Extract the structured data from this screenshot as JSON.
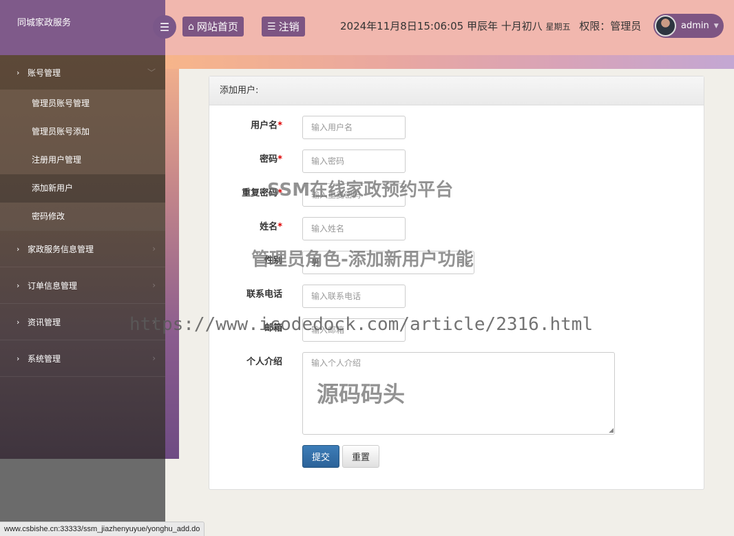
{
  "brand": {
    "title": "同城家政服务"
  },
  "header": {
    "home_label": "网站首页",
    "logout_label": "注销",
    "datetime": "2024年11月8日15:06:05 甲辰年 十月初八",
    "weekday": "星期五",
    "permission": "权限：管理员",
    "username": "admin"
  },
  "sidebar": {
    "groups": [
      {
        "label": "账号管理",
        "items": [
          {
            "label": "管理员账号管理"
          },
          {
            "label": "管理员账号添加"
          },
          {
            "label": "注册用户管理"
          },
          {
            "label": "添加新用户",
            "active": true
          },
          {
            "label": "密码修改"
          }
        ]
      },
      {
        "label": "家政服务信息管理"
      },
      {
        "label": "订单信息管理"
      },
      {
        "label": "资讯管理"
      },
      {
        "label": "系统管理"
      }
    ]
  },
  "form": {
    "heading": "添加用户:",
    "fields": {
      "username": {
        "label": "用户名",
        "required": "*",
        "placeholder": "输入用户名"
      },
      "password": {
        "label": "密码",
        "required": "*",
        "placeholder": "输入密码"
      },
      "repeat": {
        "label": "重复密码",
        "required": "*",
        "placeholder": "输入重复密码"
      },
      "name": {
        "label": "姓名",
        "required": "*",
        "placeholder": "输入姓名"
      },
      "gender": {
        "label": "性别",
        "value": "男"
      },
      "phone": {
        "label": "联系电话",
        "placeholder": "输入联系电话"
      },
      "email": {
        "label": "邮箱",
        "placeholder": "输入邮箱"
      },
      "intro": {
        "label": "个人介绍",
        "placeholder": "输入个人介绍"
      }
    },
    "submit_label": "提交",
    "reset_label": "重置"
  },
  "watermarks": {
    "line1": "SSM在线家政预约平台",
    "line2": "管理员角色-添加新用户功能",
    "line3": "https://www.icodedock.com/article/2316.html",
    "line4": "源码码头"
  },
  "statusbar": {
    "url": "www.csbishe.cn:33333/ssm_jiazhenyuyue/yonghu_add.do"
  }
}
